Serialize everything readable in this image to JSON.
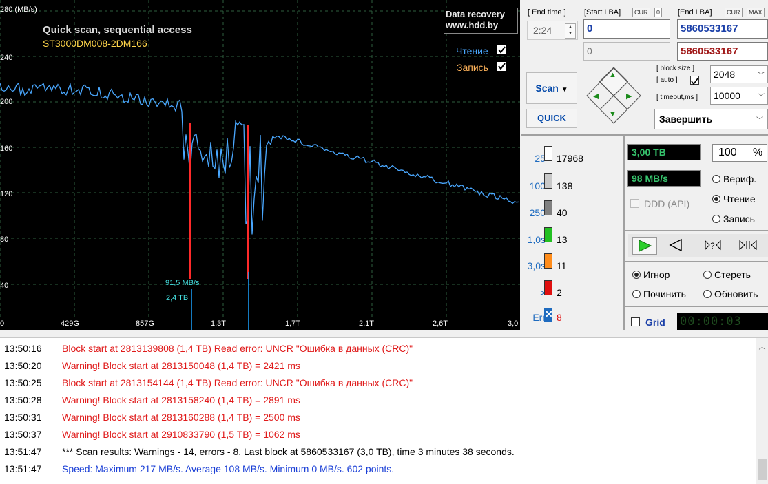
{
  "graph": {
    "ytitle": "280 (MB/s)",
    "yticks": [
      "240",
      "200",
      "160",
      "120",
      "80",
      "40"
    ],
    "xticks": [
      "0",
      "429G",
      "857G",
      "1,3T",
      "1,7T",
      "2,1T",
      "2,6T",
      "3,0"
    ],
    "title": "Quick scan, sequential access",
    "drive": "ST3000DM008-2DM166",
    "brand_line1": "Data recovery",
    "brand_line2": "www.hdd.by",
    "legend_read": "Чтение",
    "legend_write": "Запись",
    "cursor_speed": "91,5 MB/s",
    "cursor_pos": "2,4 TB",
    "colors": {
      "curve": "#4aa8ff",
      "error": "#ff2a2a",
      "cursor": "#1aa3ff",
      "title": "#ffd54a",
      "grid": "#2e5e3e"
    }
  },
  "controls": {
    "end_time_label": "[ End time ]",
    "end_time_value": "2:24",
    "start_lba_label": "[Start LBA]",
    "cur_label": "CUR",
    "start_cur_value": "0",
    "end_lba_label": "[End LBA]",
    "max_label": "MAX",
    "start_lba": "0",
    "end_lba": "5860533167",
    "start_lba_2": "0",
    "end_lba_2": "5860533167",
    "block_size_label": "[ block size ]",
    "auto_label": "[ auto ]",
    "timeout_label": "[ timeout,ms ]",
    "block_size": "2048",
    "timeout": "10000",
    "scan_button": "Scan",
    "quick_button": "QUICK",
    "action_select": "Завершить"
  },
  "counters": [
    {
      "label": "25",
      "value": "17968",
      "color": "#ffffff"
    },
    {
      "label": "100",
      "value": "138",
      "color": "#c8c8c8"
    },
    {
      "label": "250",
      "value": "40",
      "color": "#808080"
    },
    {
      "label": "1,0s",
      "value": "13",
      "color": "#22c022"
    },
    {
      "label": "3,0s",
      "value": "11",
      "color": "#ff8c1a"
    },
    {
      "label": ">",
      "value": "2",
      "color": "#e01010"
    },
    {
      "label": "Err",
      "value": "8",
      "color": "#1e6bbf"
    }
  ],
  "status": {
    "position": "3,00 TB",
    "percent": "100",
    "percent_sign": "%",
    "speed": "98 MB/s",
    "ddd_label": "DDD (API)",
    "mode_verify": "Вериф.",
    "mode_read": "Чтение",
    "mode_write": "Запись",
    "err_ignore": "Игнор",
    "err_erase": "Стереть",
    "err_repair": "Починить",
    "err_refresh": "Обновить",
    "grid_label": "Grid",
    "timer": "00:00:03"
  },
  "log": [
    {
      "time": "13:50:16",
      "msg": "Block start at 2813139808 (1,4 TB) Read error: UNCR \"Ошибка в данных (CRC)\"",
      "color": "#e01b1b"
    },
    {
      "time": "13:50:20",
      "msg": "Warning! Block start at 2813150048 (1,4 TB)  = 2421 ms",
      "color": "#e01b1b"
    },
    {
      "time": "13:50:25",
      "msg": "Block start at 2813154144 (1,4 TB) Read error: UNCR \"Ошибка в данных (CRC)\"",
      "color": "#e01b1b"
    },
    {
      "time": "13:50:28",
      "msg": "Warning! Block start at 2813158240 (1,4 TB)  = 2891 ms",
      "color": "#e01b1b"
    },
    {
      "time": "13:50:31",
      "msg": "Warning! Block start at 2813160288 (1,4 TB)  = 2500 ms",
      "color": "#e01b1b"
    },
    {
      "time": "13:50:37",
      "msg": "Warning! Block start at 2910833790 (1,5 TB)  = 1062 ms",
      "color": "#e01b1b"
    },
    {
      "time": "13:51:47",
      "msg": "*** Scan results: Warnings - 14, errors - 8. Last block at 5860533167 (3,0 TB), time 3 minutes 38 seconds.",
      "color": "#000000"
    },
    {
      "time": "13:51:47",
      "msg": "Speed: Maximum 217 MB/s. Average 108 MB/s. Minimum 0 MB/s. 602 points.",
      "color": "#1a3fd6"
    }
  ]
}
